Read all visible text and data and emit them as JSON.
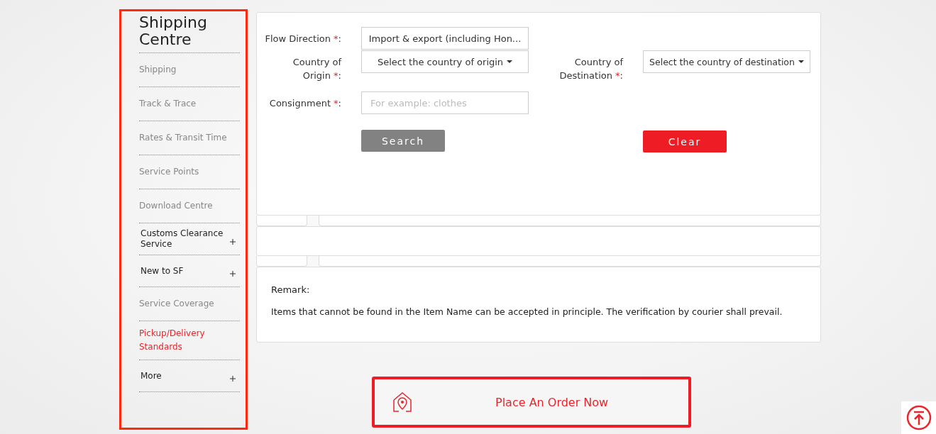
{
  "sidebar": {
    "title": "Shipping Centre",
    "items": [
      {
        "label": "Shipping",
        "selected": false,
        "expandable": false
      },
      {
        "label": "Track & Trace",
        "selected": false,
        "expandable": false
      },
      {
        "label": "Rates & Transit Time",
        "selected": false,
        "expandable": false
      },
      {
        "label": "Service Points",
        "selected": false,
        "expandable": false
      },
      {
        "label": "Download Centre",
        "selected": false,
        "expandable": false
      },
      {
        "label": "Customs Clearance Service",
        "selected": false,
        "expandable": true
      },
      {
        "label": "New to SF",
        "selected": false,
        "expandable": true
      },
      {
        "label": "Service Coverage",
        "selected": false,
        "expandable": false
      },
      {
        "label": "Pickup/Delivery Standards",
        "selected": true,
        "expandable": false
      },
      {
        "label": "More",
        "selected": false,
        "expandable": true
      }
    ]
  },
  "form": {
    "fields": [
      {
        "kind": "select",
        "label": "Flow Direction",
        "mark": "*",
        "suffix": ":",
        "value": "Import & export (including Hon..."
      },
      {
        "kind": "dropdown",
        "label": "Country of Origin",
        "mark": "*",
        "suffix": ":",
        "value": "Select the country of origin"
      },
      {
        "kind": "dropdown",
        "label": "Country of Destination",
        "mark": "*",
        "suffix": ":",
        "value": "Select the country of destination"
      },
      {
        "kind": "input",
        "label": "Consignment",
        "mark": "*",
        "suffix": ":",
        "placeholder": "For example: clothes"
      }
    ],
    "buttons": [
      {
        "label": "Search",
        "kind": "secondary"
      },
      {
        "label": "Clear",
        "kind": "primary"
      }
    ]
  },
  "remark": {
    "title": "Remark:",
    "text": "Items that cannot be found in the Item Name can be accepted in principle. The verification by courier shall prevail."
  },
  "order_button": {
    "label": "Place An Order Now"
  }
}
